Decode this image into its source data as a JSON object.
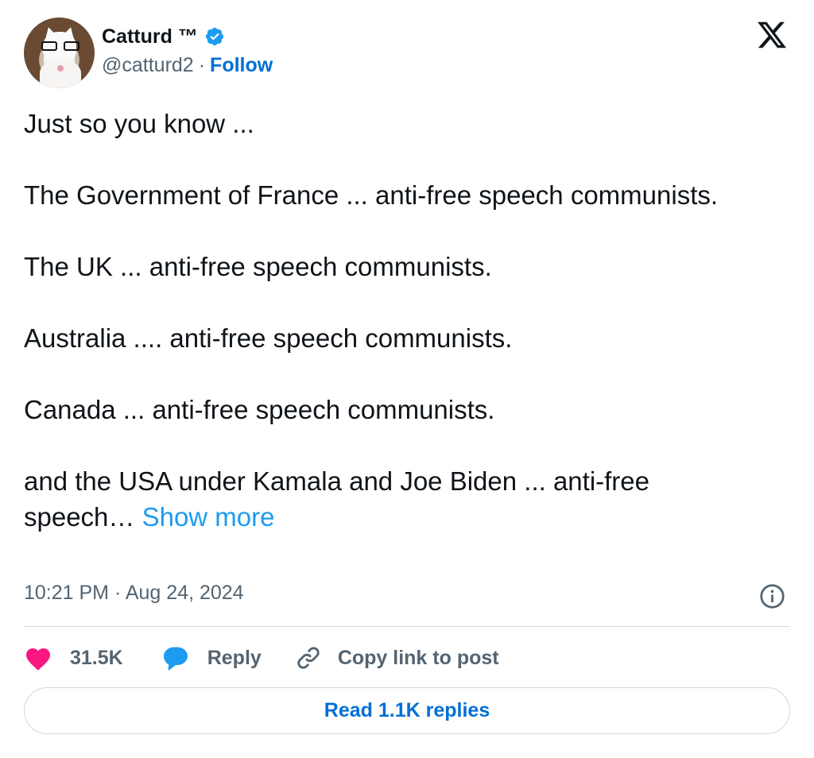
{
  "author": {
    "display_name": "Catturd ™",
    "handle": "@catturd2",
    "separator": "·",
    "follow_label": "Follow",
    "verified_icon": "verified-badge-icon",
    "verified_color": "#1d9bf0"
  },
  "platform_logo": "x-logo-icon",
  "tweet": {
    "paragraphs": [
      "Just so you know  ...",
      "The Government of France  ... anti-free speech communists.",
      "The UK ... anti-free speech communists.",
      "Australia .... anti-free speech communists.",
      "Canada ...  anti-free speech communists.",
      "and the USA under Kamala and Joe Biden ... anti-free speech…"
    ],
    "show_more_label": "Show more"
  },
  "meta": {
    "timestamp": "10:21 PM · Aug 24, 2024",
    "info_icon": "info-icon"
  },
  "actions": {
    "like_count": "31.5K",
    "like_icon": "heart-icon",
    "like_color": "#f91880",
    "reply_label": "Reply",
    "reply_icon": "reply-bubble-icon",
    "reply_color": "#1d9bf0",
    "copy_label": "Copy link to post",
    "copy_icon": "link-icon"
  },
  "read_replies_label": "Read 1.1K replies"
}
